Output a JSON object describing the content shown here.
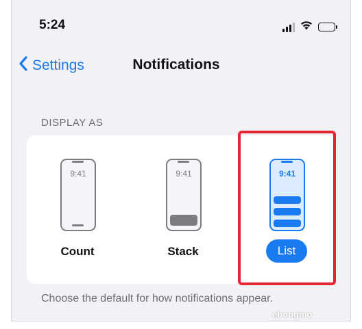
{
  "status_bar": {
    "time": "5:24",
    "icons": [
      "cellular-signal-icon",
      "wifi-icon",
      "battery-icon"
    ]
  },
  "nav": {
    "back_label": "Settings",
    "title": "Notifications"
  },
  "display_as": {
    "header": "DISPLAY AS",
    "options": [
      {
        "label": "Count",
        "phone_time": "9:41",
        "selected": false
      },
      {
        "label": "Stack",
        "phone_time": "9:41",
        "selected": false
      },
      {
        "label": "List",
        "phone_time": "9:41",
        "selected": true
      }
    ],
    "footer": "Choose the default for how notifications appear."
  },
  "watermark": "ebongmo bieht.com",
  "colors": {
    "accent": "#1a7aef",
    "highlight": "#e42433",
    "background": "#f2f2f6",
    "secondary_text": "#6d6d72"
  }
}
